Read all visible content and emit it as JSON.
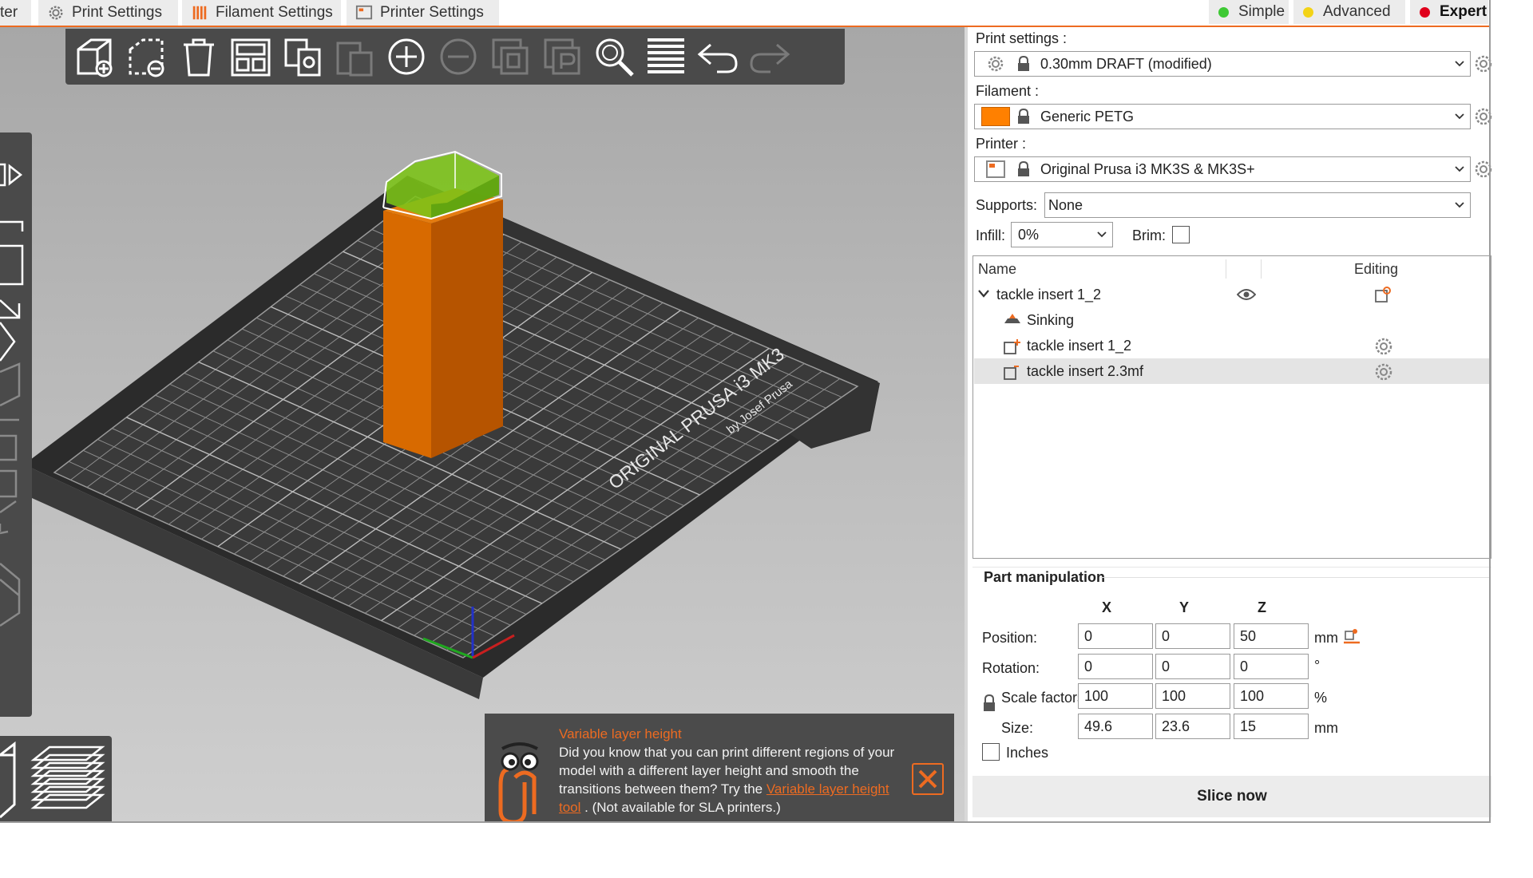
{
  "tabs": {
    "plater": "ter",
    "print_settings": "Print Settings",
    "filament_settings": "Filament Settings",
    "printer_settings": "Printer Settings"
  },
  "modes": {
    "simple": "Simple",
    "advanced": "Advanced",
    "expert": "Expert",
    "simple_color": "#3ec934",
    "advanced_color": "#f3d316",
    "expert_color": "#e0001b"
  },
  "accent_color": "#ed6b21",
  "bed": {
    "brand_line1": "ORIGINAL PRUSA i3 MK3",
    "brand_line2": "by Josef Prusa"
  },
  "toolbar_icons": [
    "add-icon",
    "delete-icon",
    "delete-all-icon",
    "arrange-icon",
    "copy-icon",
    "paste-icon",
    "add-instance-icon",
    "remove-instance-icon",
    "split-objects-icon",
    "split-parts-icon",
    "search-icon",
    "layers-editing-icon",
    "undo-icon",
    "redo-icon"
  ],
  "hint": {
    "title": "Variable layer height",
    "body_before": "Did you know that you can print different regions of your model with a different layer height and smooth the transitions between them? Try the ",
    "link": "Variable layer height tool",
    "body_after": " . (Not available for SLA printers.)"
  },
  "sidebar": {
    "print_settings_label": "Print settings :",
    "print_settings_value": "0.30mm DRAFT (modified)",
    "filament_label": "Filament :",
    "filament_value": "Generic PETG",
    "filament_color": "#ff8000",
    "printer_label": "Printer :",
    "printer_value": "Original Prusa i3 MK3S & MK3S+",
    "supports_label": "Supports:",
    "supports_value": "None",
    "infill_label": "Infill:",
    "infill_value": "0%",
    "brim_label": "Brim:",
    "brim_checked": false
  },
  "object_list": {
    "col_name": "Name",
    "col_editing": "Editing",
    "rows": [
      {
        "label": "tackle insert 1_2"
      },
      {
        "label": "Sinking"
      },
      {
        "label": "tackle insert 1_2"
      },
      {
        "label": "tackle insert 2.3mf"
      }
    ]
  },
  "part_manipulation": {
    "title": "Part manipulation",
    "col_x": "X",
    "col_y": "Y",
    "col_z": "Z",
    "position_label": "Position:",
    "rotation_label": "Rotation:",
    "scale_label": "Scale factors:",
    "size_label": "Size:",
    "position": [
      "0",
      "0",
      "50"
    ],
    "rotation": [
      "0",
      "0",
      "0"
    ],
    "scale": [
      "100",
      "100",
      "100"
    ],
    "size": [
      "49.6",
      "23.6",
      "15"
    ],
    "unit_mm": "mm",
    "unit_deg": "°",
    "unit_pct": "%",
    "inches_label": "Inches"
  },
  "slice_button": "Slice now"
}
